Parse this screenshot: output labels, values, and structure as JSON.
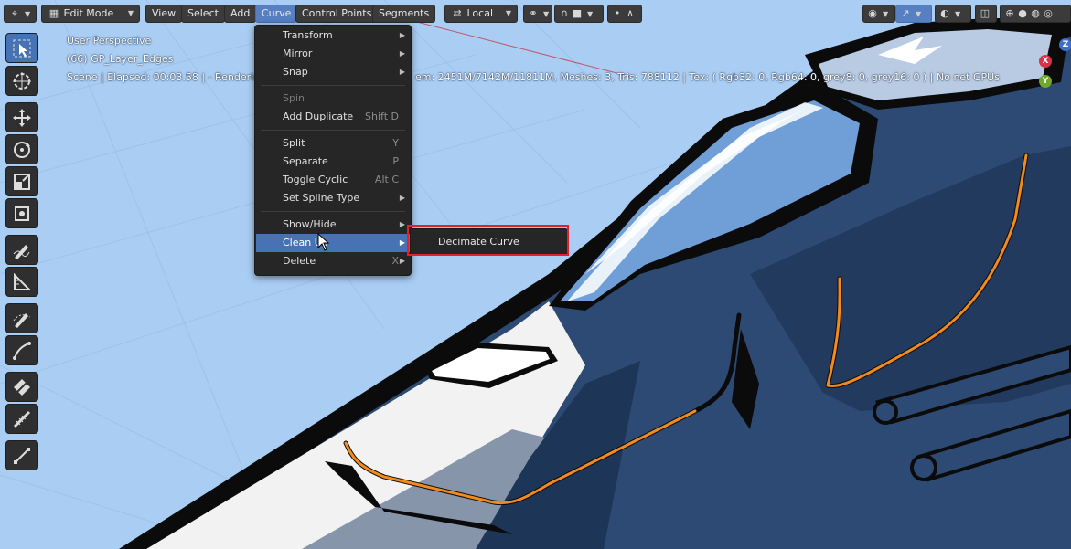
{
  "header": {
    "editor_icon": "viewport-editor-icon",
    "mode": "Edit Mode",
    "menus": [
      "View",
      "Select",
      "Add",
      "Curve",
      "Control Points",
      "Segments"
    ],
    "active_menu": "Curve",
    "transform_orientation": "Local"
  },
  "overlay": {
    "view_name": "User Perspective",
    "object_name": "(66) GP_Layer_Edges",
    "stats_left": "Scene | Elapsed: 00:03.58 | - Rendering",
    "stats_right": "em: 2451M/7142M/11811M, Meshes: 3, Tris: 788112 | Tex: ( Rgb32: 0, Rgb64: 0, grey8: 0, grey16: 0 ) | No net GPUs"
  },
  "curve_menu": {
    "items": [
      {
        "label": "Transform",
        "shortcut": "",
        "submenu": true,
        "disabled": false
      },
      {
        "label": "Mirror",
        "shortcut": "",
        "submenu": true,
        "disabled": false
      },
      {
        "label": "Snap",
        "shortcut": "",
        "submenu": true,
        "disabled": false
      },
      {
        "label": "Spin",
        "shortcut": "",
        "submenu": false,
        "disabled": true
      },
      {
        "label": "Add Duplicate",
        "shortcut": "Shift D",
        "submenu": false,
        "disabled": false
      },
      {
        "label": "Split",
        "shortcut": "Y",
        "submenu": false,
        "disabled": false
      },
      {
        "label": "Separate",
        "shortcut": "P",
        "submenu": false,
        "disabled": false
      },
      {
        "label": "Toggle Cyclic",
        "shortcut": "Alt C",
        "submenu": false,
        "disabled": false
      },
      {
        "label": "Set Spline Type",
        "shortcut": "",
        "submenu": true,
        "disabled": false
      },
      {
        "label": "Show/Hide",
        "shortcut": "",
        "submenu": true,
        "disabled": false
      },
      {
        "label": "Clean Up",
        "shortcut": "",
        "submenu": true,
        "disabled": false,
        "highlighted": true
      },
      {
        "label": "Delete",
        "shortcut": "X",
        "submenu": true,
        "disabled": false
      }
    ]
  },
  "cleanup_submenu": {
    "items": [
      {
        "label": "Decimate Curve"
      }
    ]
  },
  "gizmo": {
    "z": "Z",
    "x": "X",
    "y": "Y"
  },
  "toolbar": {
    "tools": [
      "select-box-icon",
      "cursor-icon",
      "move-icon",
      "rotate-icon",
      "scale-icon",
      "transform-icon",
      "annotate-icon",
      "measure-icon",
      "draw-curve-icon",
      "pen-icon",
      "tilt-icon",
      "randomize-icon",
      "extrude-icon"
    ]
  },
  "colors": {
    "accent": "#4772b3",
    "sky": "#a9cdf3",
    "hull_dark": "#2d4a73",
    "highlight_box": "#e2212b",
    "curve": "#f28a1e"
  }
}
